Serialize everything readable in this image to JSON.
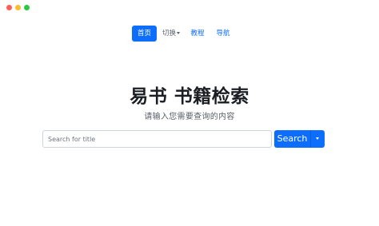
{
  "nav": {
    "home": "首页",
    "switch": "切换",
    "tutorial": "教程",
    "guide": "导航"
  },
  "hero": {
    "title": "易书 书籍检索",
    "subtitle": "请输入您需要查询的内容"
  },
  "search": {
    "placeholder": "Search for title",
    "button": "Search"
  },
  "colors": {
    "primary": "#0d6efd"
  }
}
